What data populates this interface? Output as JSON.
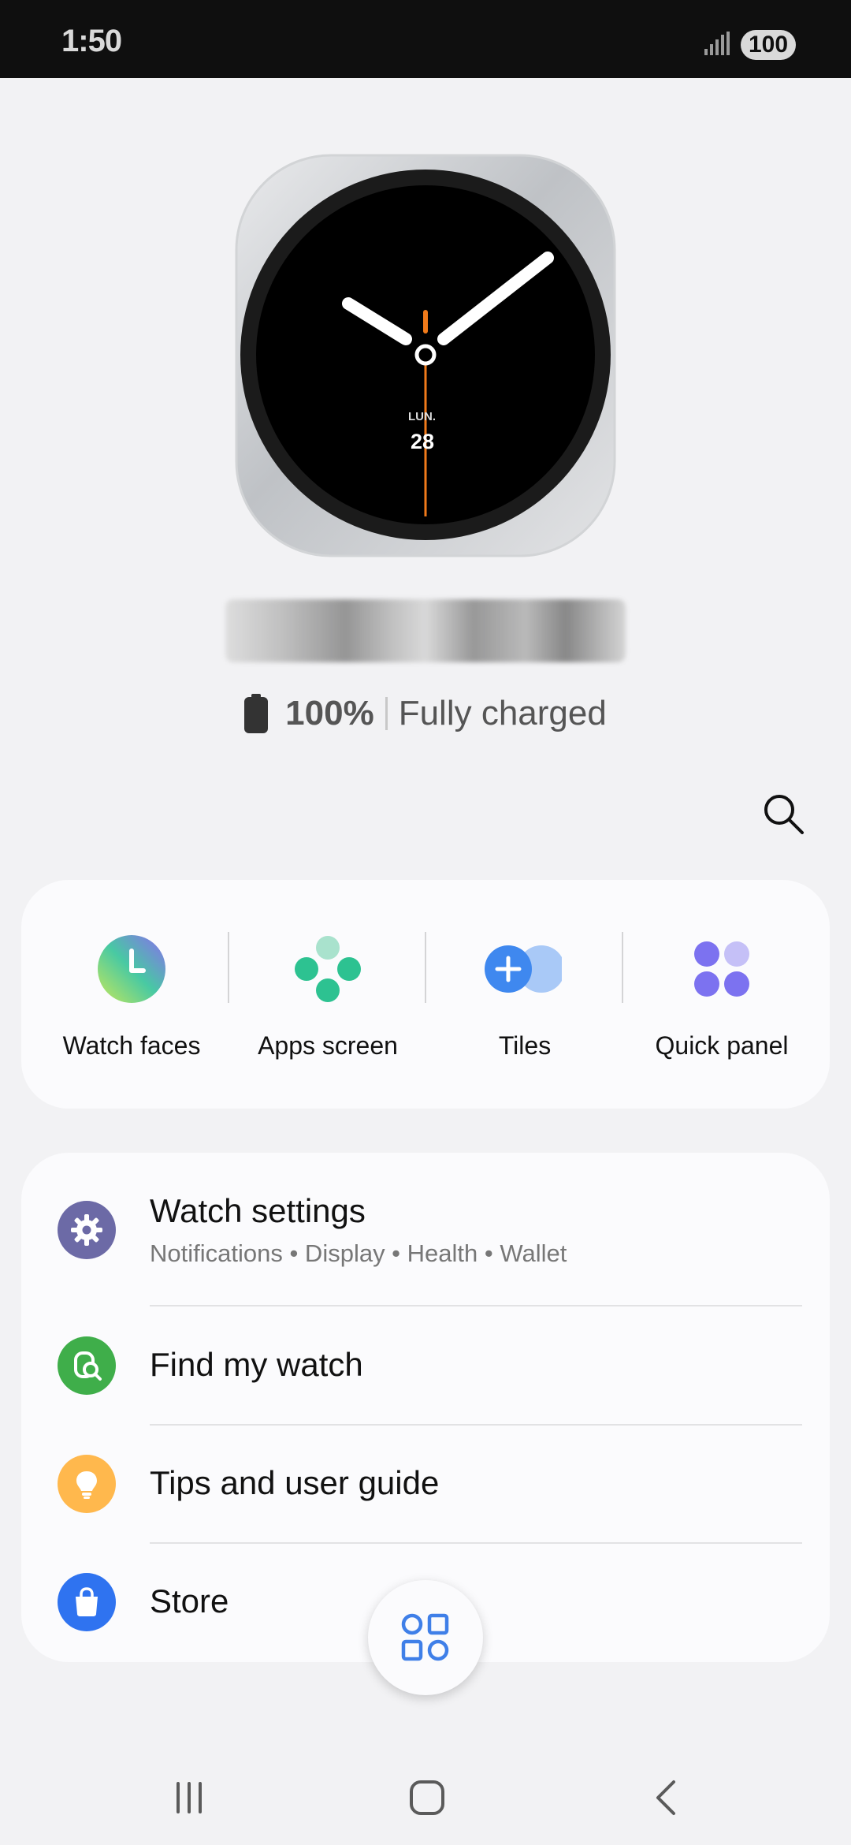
{
  "status_bar": {
    "time": "1:50",
    "battery_level": "100",
    "icons": [
      "signal-icon",
      "battery-icon"
    ]
  },
  "watch": {
    "day_label": "LUN.",
    "date_number": "28",
    "colors": {
      "face": "#000000",
      "case": "#c9cbce",
      "hands": "#ffffff",
      "accent_hand": "#f07a1a"
    }
  },
  "battery": {
    "percent": "100%",
    "status": "Fully charged"
  },
  "search": {
    "icon": "search-icon"
  },
  "shortcuts": [
    {
      "label": "Watch faces",
      "icon": "watch-faces-icon"
    },
    {
      "label": "Apps screen",
      "icon": "apps-screen-icon"
    },
    {
      "label": "Tiles",
      "icon": "tiles-icon"
    },
    {
      "label": "Quick panel",
      "icon": "quick-panel-icon"
    }
  ],
  "menu": {
    "items": [
      {
        "title": "Watch settings",
        "subtitle": "Notifications • Display • Health • Wallet",
        "icon": "gear-icon",
        "color": "#6c6aa6"
      },
      {
        "title": "Find my watch",
        "icon": "find-watch-icon",
        "color": "#3fae4a"
      },
      {
        "title": "Tips and user guide",
        "icon": "lightbulb-icon",
        "color": "#ffb84d"
      },
      {
        "title": "Store",
        "icon": "shopping-bag-icon",
        "color": "#2f73f0"
      }
    ]
  },
  "fab": {
    "icon": "apps-grid-icon"
  },
  "nav_bar": {
    "buttons": [
      "recent-apps-icon",
      "home-icon",
      "back-icon"
    ]
  }
}
